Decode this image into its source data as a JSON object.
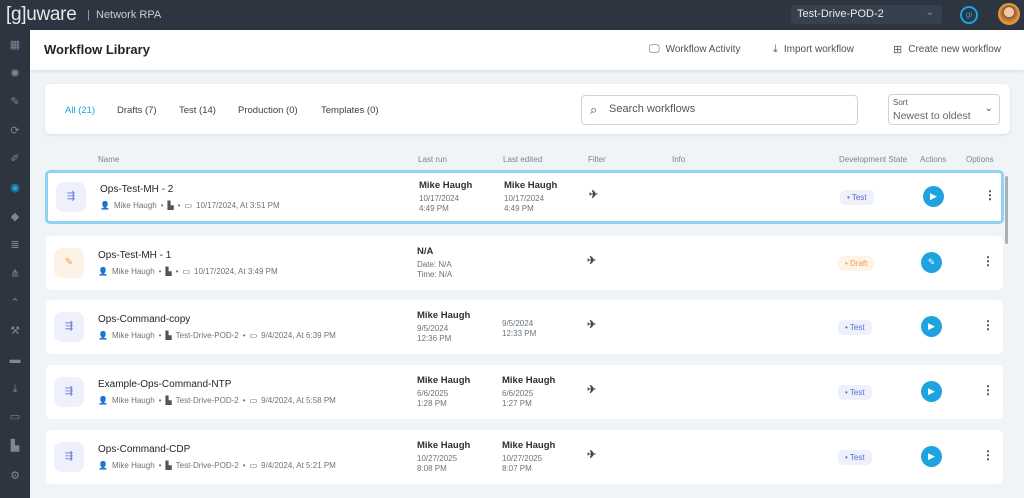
{
  "topbar": {
    "logo": "[g]uware",
    "product": "Network RPA",
    "pod": "Test-Drive-POD-2",
    "gi_label": "gi"
  },
  "header": {
    "title": "Workflow Library",
    "activity": "Workflow Activity",
    "import": "Import workflow",
    "create": "Create new workflow"
  },
  "tabs": [
    {
      "label": "All (21)"
    },
    {
      "label": "Drafts (7)"
    },
    {
      "label": "Test (14)"
    },
    {
      "label": "Production (0)"
    },
    {
      "label": "Templates (0)"
    }
  ],
  "search": {
    "placeholder": "Search workflows",
    "value": ""
  },
  "sort": {
    "label": "Sort",
    "value": "Newest to oldest"
  },
  "columns": {
    "name": "Name",
    "last_run": "Last run",
    "last_edited": "Last edited",
    "filter": "Filter",
    "info": "Info",
    "dev_state": "Development State",
    "actions": "Actions",
    "options": "Options"
  },
  "accent": "#1ea2e0",
  "rows": [
    {
      "name": "Ops-Test-MH - 2",
      "owner": "Mike Haugh",
      "site": "",
      "created": "10/17/2024, At 3:51 PM",
      "run_by": "Mike Haugh",
      "run_date": "10/17/2024",
      "run_time": "4:49 PM",
      "edit_by": "Mike Haugh",
      "edit_date": "10/17/2024",
      "edit_time": "4:49 PM",
      "state": "Test",
      "action": "play"
    },
    {
      "name": "Ops-Test-MH - 1",
      "owner": "Mike Haugh",
      "site": "",
      "created": "10/17/2024, At 3:49 PM",
      "run_by": "N/A",
      "run_date": "Date: N/A",
      "run_time": "Time: N/A",
      "edit_by": "",
      "edit_date": "",
      "edit_time": "",
      "state": "Draft",
      "action": "edit"
    },
    {
      "name": "Ops-Command-copy",
      "owner": "Mike Haugh",
      "site": "Test-Drive-POD-2",
      "created": "9/4/2024, At 6:39 PM",
      "run_by": "Mike Haugh",
      "run_date": "9/5/2024",
      "run_time": "12:36 PM",
      "edit_by": "",
      "edit_date": "9/5/2024",
      "edit_time": "12:33 PM",
      "state": "Test",
      "action": "play"
    },
    {
      "name": "Example-Ops-Command-NTP",
      "owner": "Mike Haugh",
      "site": "Test-Drive-POD-2",
      "created": "9/4/2024, At 5:58 PM",
      "run_by": "Mike Haugh",
      "run_date": "6/6/2025",
      "run_time": "1:28 PM",
      "edit_by": "Mike Haugh",
      "edit_date": "6/6/2025",
      "edit_time": "1:27 PM",
      "state": "Test",
      "action": "play"
    },
    {
      "name": "Ops-Command-CDP",
      "owner": "Mike Haugh",
      "site": "Test-Drive-POD-2",
      "created": "9/4/2024, At 5:21 PM",
      "run_by": "Mike Haugh",
      "run_date": "10/27/2025",
      "run_time": "8:08 PM",
      "edit_by": "Mike Haugh",
      "edit_date": "10/27/2025",
      "edit_time": "8:07 PM",
      "state": "Test",
      "action": "play"
    }
  ]
}
